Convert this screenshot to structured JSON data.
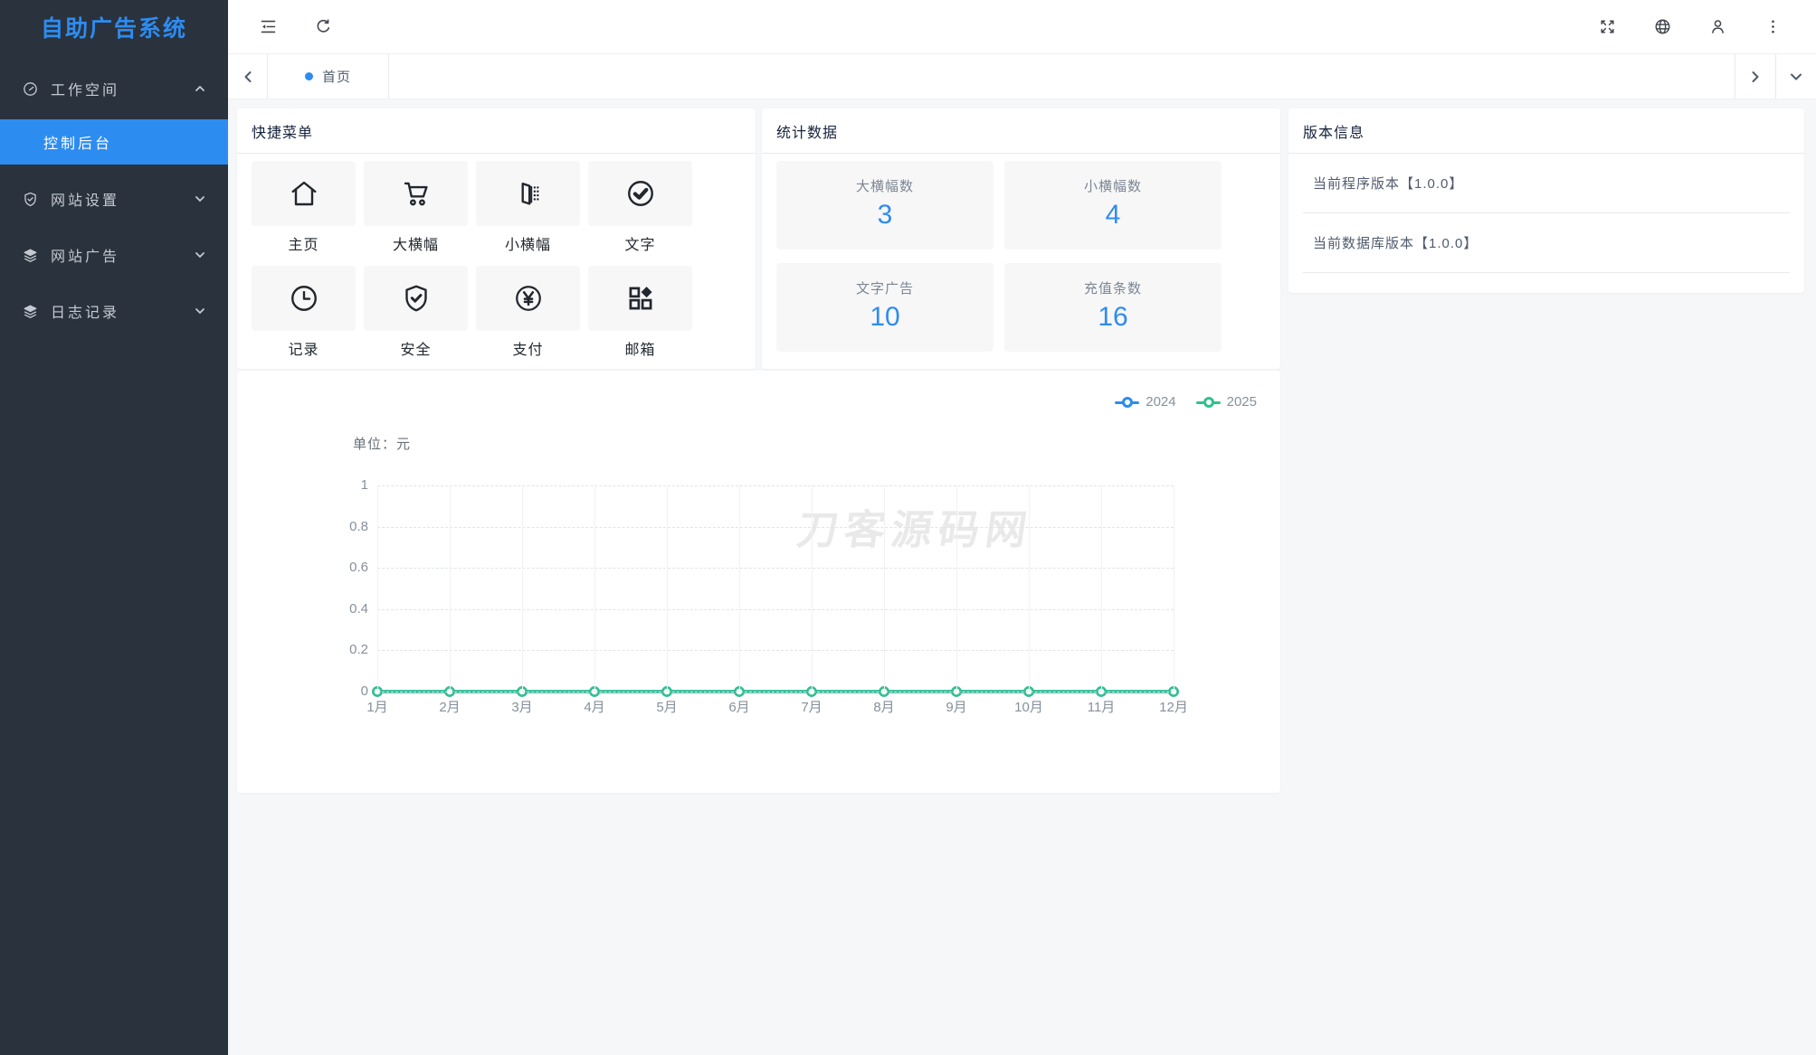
{
  "app": {
    "title": "自助广告系统"
  },
  "sidebar": {
    "items": [
      {
        "label": "工作空间",
        "icon": "dashboard-icon",
        "expanded": true
      },
      {
        "label": "网站设置",
        "icon": "shield-check-icon",
        "expanded": false
      },
      {
        "label": "网站广告",
        "icon": "layers-icon",
        "expanded": false
      },
      {
        "label": "日志记录",
        "icon": "layers-icon",
        "expanded": false
      }
    ],
    "active_submenu": {
      "label": "控制后台"
    }
  },
  "tabbar": {
    "active_tab": "首页"
  },
  "quick_menu": {
    "title": "快捷菜单",
    "items": [
      {
        "label": "主页",
        "icon": "home-icon"
      },
      {
        "label": "大横幅",
        "icon": "cart-icon"
      },
      {
        "label": "小横幅",
        "icon": "banner-dots-icon"
      },
      {
        "label": "文字",
        "icon": "check-circle-icon"
      },
      {
        "label": "记录",
        "icon": "clock-icon"
      },
      {
        "label": "安全",
        "icon": "shield-check-icon"
      },
      {
        "label": "支付",
        "icon": "yen-circle-icon"
      },
      {
        "label": "邮箱",
        "icon": "components-icon"
      }
    ]
  },
  "stats": {
    "title": "统计数据",
    "items": [
      {
        "label": "大横幅数",
        "value": "3"
      },
      {
        "label": "小横幅数",
        "value": "4"
      },
      {
        "label": "文字广告",
        "value": "10"
      },
      {
        "label": "充值条数",
        "value": "16"
      }
    ]
  },
  "version": {
    "title": "版本信息",
    "rows": [
      "当前程序版本【1.0.0】",
      "当前数据库版本【1.0.0】"
    ]
  },
  "chart_data": {
    "type": "line",
    "unit_label": "单位：元",
    "x": [
      "1月",
      "2月",
      "3月",
      "4月",
      "5月",
      "6月",
      "7月",
      "8月",
      "9月",
      "10月",
      "11月",
      "12月"
    ],
    "series": [
      {
        "name": "2024",
        "color": "#2d8cf0",
        "values": [
          0,
          0,
          0,
          0,
          0,
          0,
          0,
          0,
          0,
          0,
          0,
          0
        ]
      },
      {
        "name": "2025",
        "color": "#32c08d",
        "values": [
          0,
          0,
          0,
          0,
          0,
          0,
          0,
          0,
          0,
          0,
          0,
          0
        ]
      }
    ],
    "ylim": [
      0,
      1
    ],
    "yticks": [
      0,
      0.2,
      0.4,
      0.6,
      0.8,
      1
    ],
    "legend_position": "top-right",
    "grid": true,
    "watermark": "刀客源码网"
  },
  "colors": {
    "primary": "#2d8cf0",
    "sidebar_bg": "#2a323d",
    "page_bg": "#f5f7f9",
    "stat_value": "#2d8cf0"
  }
}
